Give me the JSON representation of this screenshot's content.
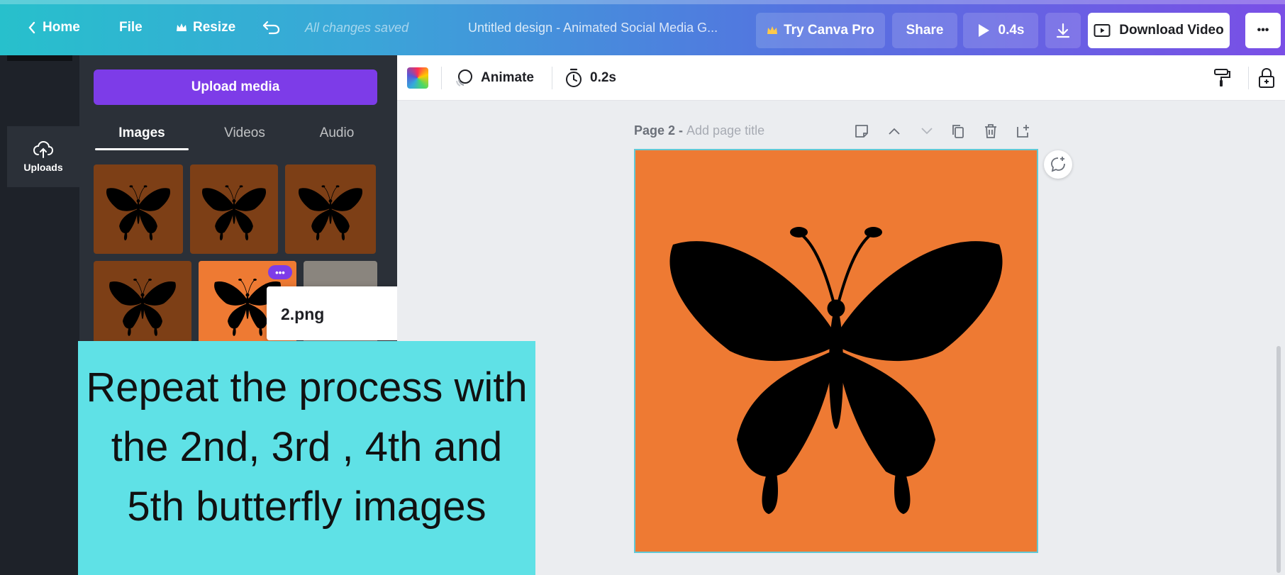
{
  "topbar": {
    "home_label": "Home",
    "file_label": "File",
    "resize_label": "Resize",
    "saved_status": "All changes saved",
    "doc_title": "Untitled design - Animated Social Media G...",
    "try_pro_label": "Try Canva Pro",
    "share_label": "Share",
    "play_duration": "0.4s",
    "download_video_label": "Download Video",
    "more_label": "•••"
  },
  "rail": {
    "uploads_label": "Uploads"
  },
  "panel": {
    "upload_button_label": "Upload media",
    "tabs": [
      {
        "label": "Images",
        "active": true
      },
      {
        "label": "Videos",
        "active": false
      },
      {
        "label": "Audio",
        "active": false
      }
    ],
    "thumb_more_label": "•••",
    "tooltip_filename": "2.png"
  },
  "editor_toolbar": {
    "animate_label": "Animate",
    "timing_label": "0.2s"
  },
  "canvas": {
    "page_label": "Page 2 - ",
    "page_title_placeholder": "Add page title"
  },
  "overlay": {
    "instruction": "Repeat the process with the 2nd, 3rd , 4th and 5th butterfly images"
  },
  "colors": {
    "accent_purple": "#7d3ce8",
    "page_orange": "#ee7a33",
    "overlay_cyan": "#5fe1e6",
    "panel_dark": "#2b3038"
  }
}
